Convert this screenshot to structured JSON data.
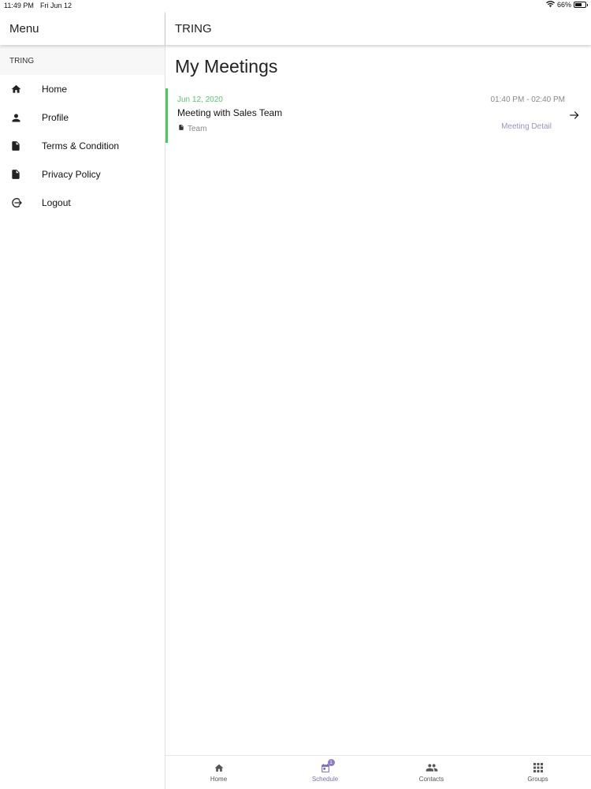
{
  "status_bar": {
    "time": "11:49 PM",
    "date": "Fri Jun 12",
    "battery": "66%",
    "battery_level": 0.66
  },
  "sidebar": {
    "title": "Menu",
    "section": "TRING",
    "items": [
      {
        "label": "Home",
        "icon": "home-icon"
      },
      {
        "label": "Profile",
        "icon": "person-icon"
      },
      {
        "label": "Terms & Condition",
        "icon": "document-icon"
      },
      {
        "label": "Privacy Policy",
        "icon": "document-icon"
      },
      {
        "label": "Logout",
        "icon": "logout-icon"
      }
    ]
  },
  "header": {
    "title": "TRING"
  },
  "main": {
    "page_title": "My Meetings",
    "meetings": [
      {
        "date": "Jun 12, 2020",
        "title": "Meeting with Sales Team",
        "type": "Team",
        "time": "01:40 PM - 02:40 PM",
        "detail_label": "Meeting Detail"
      }
    ]
  },
  "bottom_nav": {
    "items": [
      {
        "label": "Home",
        "icon": "home-icon"
      },
      {
        "label": "Schedule",
        "icon": "calendar-icon",
        "badge": "1",
        "active": true
      },
      {
        "label": "Contacts",
        "icon": "people-icon"
      },
      {
        "label": "Groups",
        "icon": "grid-icon"
      }
    ]
  },
  "colors": {
    "accent_green": "#4cc763",
    "accent_purple": "#7d6fae",
    "link_purple": "#9a93c0"
  }
}
